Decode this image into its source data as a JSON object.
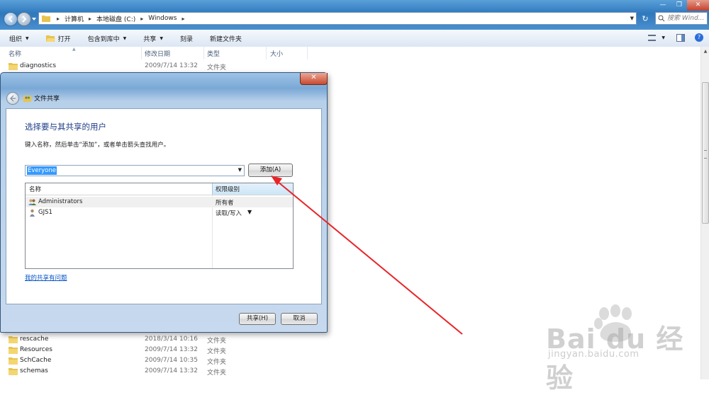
{
  "explorer": {
    "breadcrumbs": [
      "计算机",
      "本地磁盘 (C:)",
      "Windows"
    ],
    "search_placeholder": "搜索 Wind...",
    "toolbar": {
      "organize": "组织",
      "open": "打开",
      "include_in_library": "包含到库中",
      "share": "共享",
      "burn": "刻录",
      "new_folder": "新建文件夹"
    },
    "columns": {
      "name": "名称",
      "date": "修改日期",
      "type": "类型",
      "size": "大小"
    },
    "top_rows": [
      {
        "name": "diagnostics",
        "date": "2009/7/14 13:32",
        "type": "文件夹"
      }
    ],
    "bottom_rows": [
      {
        "name": "rescache",
        "date": "2018/3/14 10:16",
        "type": "文件夹"
      },
      {
        "name": "Resources",
        "date": "2009/7/14 13:32",
        "type": "文件夹"
      },
      {
        "name": "SchCache",
        "date": "2009/7/14 10:35",
        "type": "文件夹"
      },
      {
        "name": "schemas",
        "date": "2009/7/14 13:32",
        "type": "文件夹"
      }
    ]
  },
  "dialog": {
    "title": "文件共享",
    "heading": "选择要与其共享的用户",
    "instruction": "键入名称，然后单击“添加”，或者单击箭头查找用户。",
    "user_input_value": "Everyone",
    "add_button": "添加(A)",
    "list_headers": {
      "name": "名称",
      "level": "权限级别"
    },
    "users": [
      {
        "name": "Administrators",
        "level": "所有者"
      },
      {
        "name": "GJS1",
        "level": "读取/写入"
      }
    ],
    "help_link": "我的共享有问题",
    "share_button": "共享(H)",
    "cancel_button": "取消"
  },
  "watermark": {
    "brand": "Bai du 经验",
    "url": "jingyan.baidu.com"
  },
  "colors": {
    "annotation_arrow": "#e8262a",
    "heading_blue": "#1e3d87",
    "link_blue": "#0b56c9",
    "selection_blue": "#3399ff"
  }
}
